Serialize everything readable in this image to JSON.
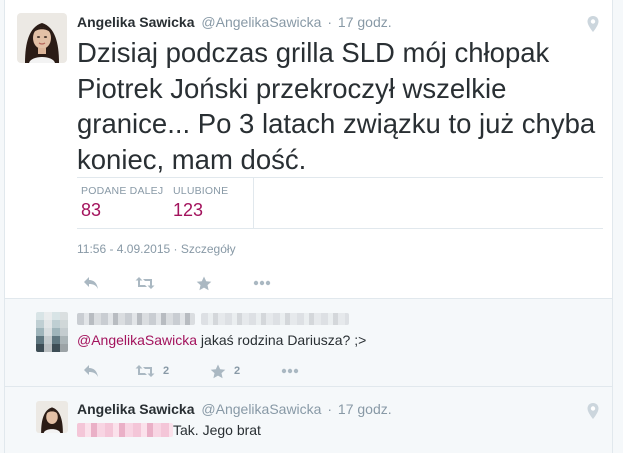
{
  "main_tweet": {
    "fullname": "Angelika Sawicka",
    "screen_name": "@AngelikaSawicka",
    "separator": "·",
    "time_ago": "17 godz.",
    "text": "Dzisiaj podczas grilla SLD mój chłopak Piotrek Joński przekroczył wszelkie granice... Po 3 latach związku to już chyba koniec, mam dość.",
    "stats": [
      {
        "label": "PODANE DALEJ",
        "value": "83"
      },
      {
        "label": "ULUBIONE",
        "value": "123"
      }
    ],
    "timestamp": "11:56 - 4.09.2015",
    "details_link": "Szczegóły"
  },
  "reply_1": {
    "mention": "@AngelikaSawicka",
    "text": " jakaś rodzina Dariusza? ;>",
    "retweet_count": "2",
    "favorite_count": "2"
  },
  "reply_2": {
    "fullname": "Angelika Sawicka",
    "screen_name": "@AngelikaSawicka",
    "separator": "·",
    "time_ago": "17 godz.",
    "text": "Tak. Jego brat"
  },
  "colors": {
    "accent": "#a3135d",
    "muted": "#8899a6",
    "border": "#e1e8ed",
    "text": "#292f33"
  },
  "icons": {
    "reply": "reply-icon",
    "retweet": "retweet-icon",
    "favorite": "star-icon",
    "more": "more-icon",
    "location": "location-pin-icon"
  }
}
